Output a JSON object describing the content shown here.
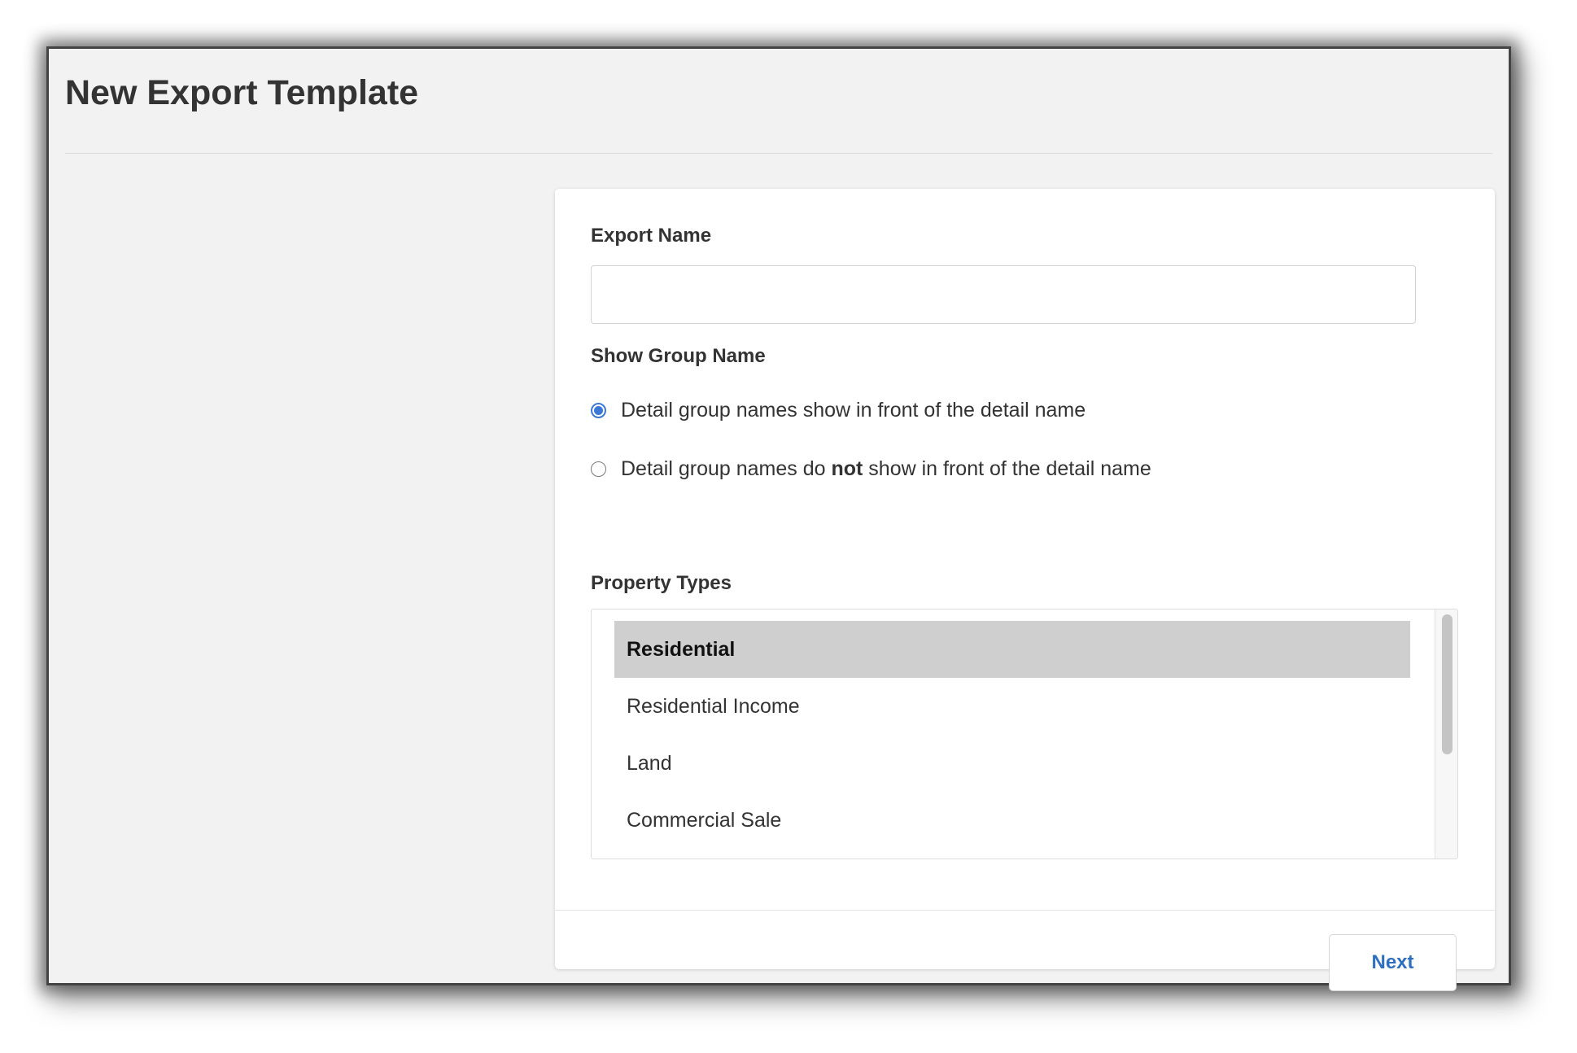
{
  "page": {
    "title": "New Export Template"
  },
  "form": {
    "export_name": {
      "label": "Export Name",
      "value": "",
      "placeholder": ""
    },
    "show_group_name": {
      "label": "Show Group Name",
      "options": [
        {
          "text_before": "Detail group names show in front of the detail name",
          "emphasis": "",
          "text_after": "",
          "checked": true
        },
        {
          "text_before": "Detail group names do ",
          "emphasis": "not",
          "text_after": " show in front of the detail name",
          "checked": false
        }
      ]
    },
    "property_types": {
      "label": "Property Types",
      "items": [
        {
          "label": "Residential",
          "selected": true
        },
        {
          "label": "Residential Income",
          "selected": false
        },
        {
          "label": "Land",
          "selected": false
        },
        {
          "label": "Commercial Sale",
          "selected": false
        }
      ]
    }
  },
  "footer": {
    "next_label": "Next"
  },
  "colors": {
    "accent": "#3b78d8",
    "link_button_text": "#2f6fc0",
    "selected_item_bg": "#cfcfcf",
    "page_bg": "#f2f2f2"
  }
}
